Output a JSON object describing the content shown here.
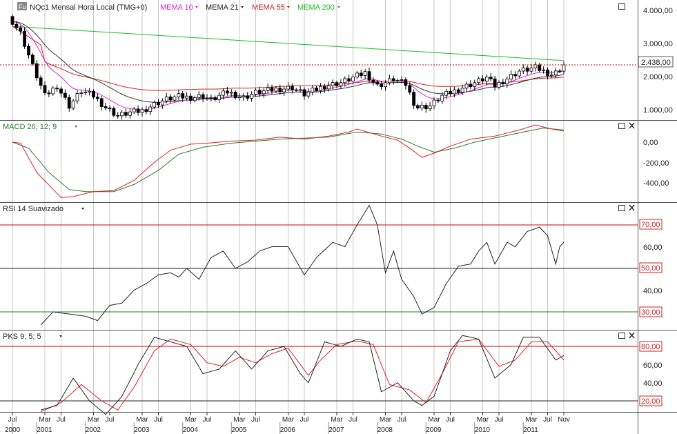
{
  "colors": {
    "candle": "#000000",
    "mema10": "#dd22dd",
    "mema21": "#333333",
    "mema55": "#cc2222",
    "mema200": "#22bb22",
    "macd": "#dd2222",
    "macd_signal": "#2a7a2a",
    "rsi": "#222222",
    "pks_k": "#222222",
    "pks_d": "#dd2222",
    "grid": "#c8c8c8",
    "priceline": "#cc0000"
  },
  "header": {
    "badge": "Fu",
    "symbol": "NQc1 Mensal Hora Local (TMG+0)",
    "mema10": "MEMA 10",
    "mema21": "MEMA 21",
    "mema55": "MEMA 55",
    "mema200": "MEMA 200"
  },
  "panels": {
    "price": {
      "y_labels": [
        "4.000,00",
        "3.000,00",
        "2.000,00",
        "1.000,00"
      ],
      "current_label": "2.438,00"
    },
    "macd": {
      "title": "MACD 26; 12; 9",
      "y_labels": [
        "0,00",
        "-200,00",
        "-400,00"
      ]
    },
    "rsi": {
      "title": "RSI 14 Suavizado",
      "y_labels": [
        "70,00",
        "60,00",
        "50,00",
        "40,00",
        "30,00"
      ]
    },
    "pks": {
      "title": "PKS 9; 5; 5",
      "y_labels": [
        "80,00",
        "60,00",
        "40,00",
        "20,00"
      ]
    }
  },
  "x_axis": {
    "month_labels": [
      "Jul",
      "Mar",
      "Jul",
      "Mar",
      "Jul",
      "Mar",
      "Jul",
      "Mar",
      "Jul",
      "Mar",
      "Jul",
      "Mar",
      "Jul",
      "Mar",
      "Jul",
      "Mar",
      "Jul",
      "Mar",
      "Jul",
      "Mar",
      "Jul",
      "Mar",
      "Jul",
      "Nov"
    ],
    "year_labels": [
      "2000",
      "2001",
      "2002",
      "2003",
      "2004",
      "2005",
      "2006",
      "2007",
      "2008",
      "2009",
      "2010",
      "2011"
    ]
  },
  "chart_data": [
    {
      "type": "candlestick",
      "title": "NQc1 Mensal Hora Local (TMG+0)",
      "ylim": [
        600,
        4300
      ],
      "x_range": [
        "2000-07",
        "2011-11"
      ],
      "anchors_close": [
        [
          "2000-07",
          3750
        ],
        [
          "2000-09",
          3400
        ],
        [
          "2000-12",
          2400
        ],
        [
          "2001-03",
          1500
        ],
        [
          "2001-06",
          1800
        ],
        [
          "2001-09",
          1200
        ],
        [
          "2001-12",
          1650
        ],
        [
          "2002-03",
          1500
        ],
        [
          "2002-06",
          1150
        ],
        [
          "2002-09",
          900
        ],
        [
          "2002-12",
          1000
        ],
        [
          "2003-03",
          1050
        ],
        [
          "2003-06",
          1250
        ],
        [
          "2003-09",
          1400
        ],
        [
          "2003-12",
          1480
        ],
        [
          "2004-03",
          1450
        ],
        [
          "2004-06",
          1500
        ],
        [
          "2004-08",
          1380
        ],
        [
          "2004-12",
          1620
        ],
        [
          "2005-04",
          1450
        ],
        [
          "2005-07",
          1600
        ],
        [
          "2005-12",
          1700
        ],
        [
          "2006-04",
          1750
        ],
        [
          "2006-07",
          1550
        ],
        [
          "2006-12",
          1800
        ],
        [
          "2007-04",
          1900
        ],
        [
          "2007-10",
          2200
        ],
        [
          "2008-01",
          1800
        ],
        [
          "2008-05",
          2000
        ],
        [
          "2008-08",
          1850
        ],
        [
          "2008-10",
          1300
        ],
        [
          "2008-11",
          1150
        ],
        [
          "2009-02",
          1200
        ],
        [
          "2009-05",
          1500
        ],
        [
          "2009-09",
          1700
        ],
        [
          "2009-12",
          1850
        ],
        [
          "2010-04",
          2050
        ],
        [
          "2010-06",
          1800
        ],
        [
          "2010-10",
          2100
        ],
        [
          "2010-12",
          2250
        ],
        [
          "2011-04",
          2350
        ],
        [
          "2011-08",
          2150
        ],
        [
          "2011-09",
          2200
        ],
        [
          "2011-11",
          2438
        ]
      ],
      "series": [
        {
          "name": "MEMA 10"
        },
        {
          "name": "MEMA 21"
        },
        {
          "name": "MEMA 55"
        },
        {
          "name": "MEMA 200"
        }
      ]
    },
    {
      "type": "line",
      "title": "MACD 26; 12; 9",
      "ylim": [
        -600,
        150
      ],
      "series": [
        {
          "values": [
            [
              "2000-07",
              0
            ],
            [
              "2000-09",
              -10
            ],
            [
              "2001-01",
              -300
            ],
            [
              "2001-07",
              -550
            ],
            [
              "2001-10",
              -540
            ],
            [
              "2002-03",
              -490
            ],
            [
              "2002-08",
              -480
            ],
            [
              "2003-01",
              -380
            ],
            [
              "2003-06",
              -200
            ],
            [
              "2003-10",
              -80
            ],
            [
              "2004-03",
              -20
            ],
            [
              "2004-07",
              -10
            ],
            [
              "2005-01",
              10
            ],
            [
              "2005-07",
              20
            ],
            [
              "2006-01",
              50
            ],
            [
              "2006-07",
              30
            ],
            [
              "2007-01",
              60
            ],
            [
              "2007-06",
              100
            ],
            [
              "2007-08",
              130
            ],
            [
              "2008-02",
              60
            ],
            [
              "2008-06",
              20
            ],
            [
              "2008-09",
              -60
            ],
            [
              "2008-12",
              -150
            ],
            [
              "2009-03",
              -110
            ],
            [
              "2009-07",
              -40
            ],
            [
              "2009-12",
              30
            ],
            [
              "2010-06",
              60
            ],
            [
              "2010-12",
              120
            ],
            [
              "2011-04",
              170
            ],
            [
              "2011-08",
              130
            ],
            [
              "2011-11",
              110
            ]
          ]
        },
        {
          "values": [
            [
              "2000-07",
              0
            ],
            [
              "2000-11",
              -60
            ],
            [
              "2001-04",
              -300
            ],
            [
              "2001-09",
              -470
            ],
            [
              "2002-01",
              -490
            ],
            [
              "2002-08",
              -490
            ],
            [
              "2003-01",
              -420
            ],
            [
              "2003-07",
              -280
            ],
            [
              "2003-12",
              -120
            ],
            [
              "2004-06",
              -50
            ],
            [
              "2005-01",
              -10
            ],
            [
              "2005-07",
              10
            ],
            [
              "2006-01",
              30
            ],
            [
              "2006-07",
              40
            ],
            [
              "2007-01",
              50
            ],
            [
              "2007-08",
              100
            ],
            [
              "2008-02",
              80
            ],
            [
              "2008-07",
              30
            ],
            [
              "2008-11",
              -40
            ],
            [
              "2009-03",
              -100
            ],
            [
              "2009-08",
              -60
            ],
            [
              "2010-01",
              0
            ],
            [
              "2010-07",
              50
            ],
            [
              "2011-01",
              100
            ],
            [
              "2011-06",
              140
            ],
            [
              "2011-11",
              120
            ]
          ]
        }
      ]
    },
    {
      "type": "line",
      "title": "RSI 14 Suavizado",
      "ylim": [
        20,
        80
      ],
      "values": [
        [
          "2001-02",
          24
        ],
        [
          "2001-05",
          30
        ],
        [
          "2001-09",
          29
        ],
        [
          "2002-01",
          28
        ],
        [
          "2002-04",
          26
        ],
        [
          "2002-07",
          33
        ],
        [
          "2002-10",
          34
        ],
        [
          "2003-01",
          40
        ],
        [
          "2003-04",
          43
        ],
        [
          "2003-07",
          47
        ],
        [
          "2003-10",
          48
        ],
        [
          "2003-12",
          46
        ],
        [
          "2004-02",
          50
        ],
        [
          "2004-05",
          45
        ],
        [
          "2004-08",
          55
        ],
        [
          "2004-11",
          58
        ],
        [
          "2005-02",
          50
        ],
        [
          "2005-05",
          53
        ],
        [
          "2005-08",
          58
        ],
        [
          "2005-11",
          60
        ],
        [
          "2006-03",
          60
        ],
        [
          "2006-07",
          47
        ],
        [
          "2006-10",
          55
        ],
        [
          "2007-02",
          62
        ],
        [
          "2007-05",
          60
        ],
        [
          "2007-08",
          70
        ],
        [
          "2007-11",
          79
        ],
        [
          "2008-01",
          70
        ],
        [
          "2008-03",
          48
        ],
        [
          "2008-05",
          58
        ],
        [
          "2008-07",
          45
        ],
        [
          "2008-10",
          37
        ],
        [
          "2008-12",
          29
        ],
        [
          "2009-03",
          32
        ],
        [
          "2009-06",
          43
        ],
        [
          "2009-09",
          51
        ],
        [
          "2009-12",
          52
        ],
        [
          "2010-02",
          58
        ],
        [
          "2010-04",
          62
        ],
        [
          "2010-06",
          52
        ],
        [
          "2010-09",
          62
        ],
        [
          "2010-11",
          60
        ],
        [
          "2011-02",
          67
        ],
        [
          "2011-05",
          69
        ],
        [
          "2011-07",
          65
        ],
        [
          "2011-09",
          52
        ],
        [
          "2011-10",
          60
        ],
        [
          "2011-11",
          62
        ]
      ]
    },
    {
      "type": "line",
      "title": "PKS 9; 5; 5",
      "ylim": [
        0,
        100
      ],
      "series": [
        {
          "values": [
            [
              "2001-02",
              10
            ],
            [
              "2001-06",
              15
            ],
            [
              "2001-10",
              45
            ],
            [
              "2002-02",
              20
            ],
            [
              "2002-06",
              5
            ],
            [
              "2002-10",
              25
            ],
            [
              "2003-02",
              60
            ],
            [
              "2003-06",
              90
            ],
            [
              "2003-10",
              85
            ],
            [
              "2004-02",
              80
            ],
            [
              "2004-06",
              50
            ],
            [
              "2004-10",
              55
            ],
            [
              "2005-02",
              75
            ],
            [
              "2005-06",
              55
            ],
            [
              "2005-10",
              75
            ],
            [
              "2006-02",
              80
            ],
            [
              "2006-06",
              50
            ],
            [
              "2006-08",
              40
            ],
            [
              "2006-12",
              85
            ],
            [
              "2007-04",
              80
            ],
            [
              "2007-08",
              88
            ],
            [
              "2007-11",
              85
            ],
            [
              "2008-02",
              30
            ],
            [
              "2008-06",
              40
            ],
            [
              "2008-10",
              20
            ],
            [
              "2008-12",
              15
            ],
            [
              "2009-03",
              25
            ],
            [
              "2009-07",
              75
            ],
            [
              "2009-10",
              92
            ],
            [
              "2010-02",
              88
            ],
            [
              "2010-06",
              45
            ],
            [
              "2010-10",
              60
            ],
            [
              "2011-01",
              90
            ],
            [
              "2011-05",
              90
            ],
            [
              "2011-09",
              65
            ],
            [
              "2011-11",
              70
            ]
          ]
        },
        {
          "values": [
            [
              "2001-02",
              8
            ],
            [
              "2001-07",
              18
            ],
            [
              "2001-12",
              38
            ],
            [
              "2002-05",
              20
            ],
            [
              "2002-09",
              10
            ],
            [
              "2003-01",
              35
            ],
            [
              "2003-06",
              75
            ],
            [
              "2003-10",
              88
            ],
            [
              "2004-03",
              82
            ],
            [
              "2004-07",
              62
            ],
            [
              "2004-11",
              58
            ],
            [
              "2005-03",
              68
            ],
            [
              "2005-07",
              62
            ],
            [
              "2005-11",
              72
            ],
            [
              "2006-03",
              78
            ],
            [
              "2006-08",
              48
            ],
            [
              "2006-11",
              65
            ],
            [
              "2007-03",
              82
            ],
            [
              "2007-08",
              86
            ],
            [
              "2007-12",
              82
            ],
            [
              "2008-04",
              38
            ],
            [
              "2008-09",
              32
            ],
            [
              "2009-01",
              18
            ],
            [
              "2009-05",
              50
            ],
            [
              "2009-09",
              85
            ],
            [
              "2010-02",
              88
            ],
            [
              "2010-07",
              58
            ],
            [
              "2010-11",
              65
            ],
            [
              "2011-03",
              85
            ],
            [
              "2011-07",
              85
            ],
            [
              "2011-11",
              65
            ]
          ]
        }
      ]
    }
  ]
}
